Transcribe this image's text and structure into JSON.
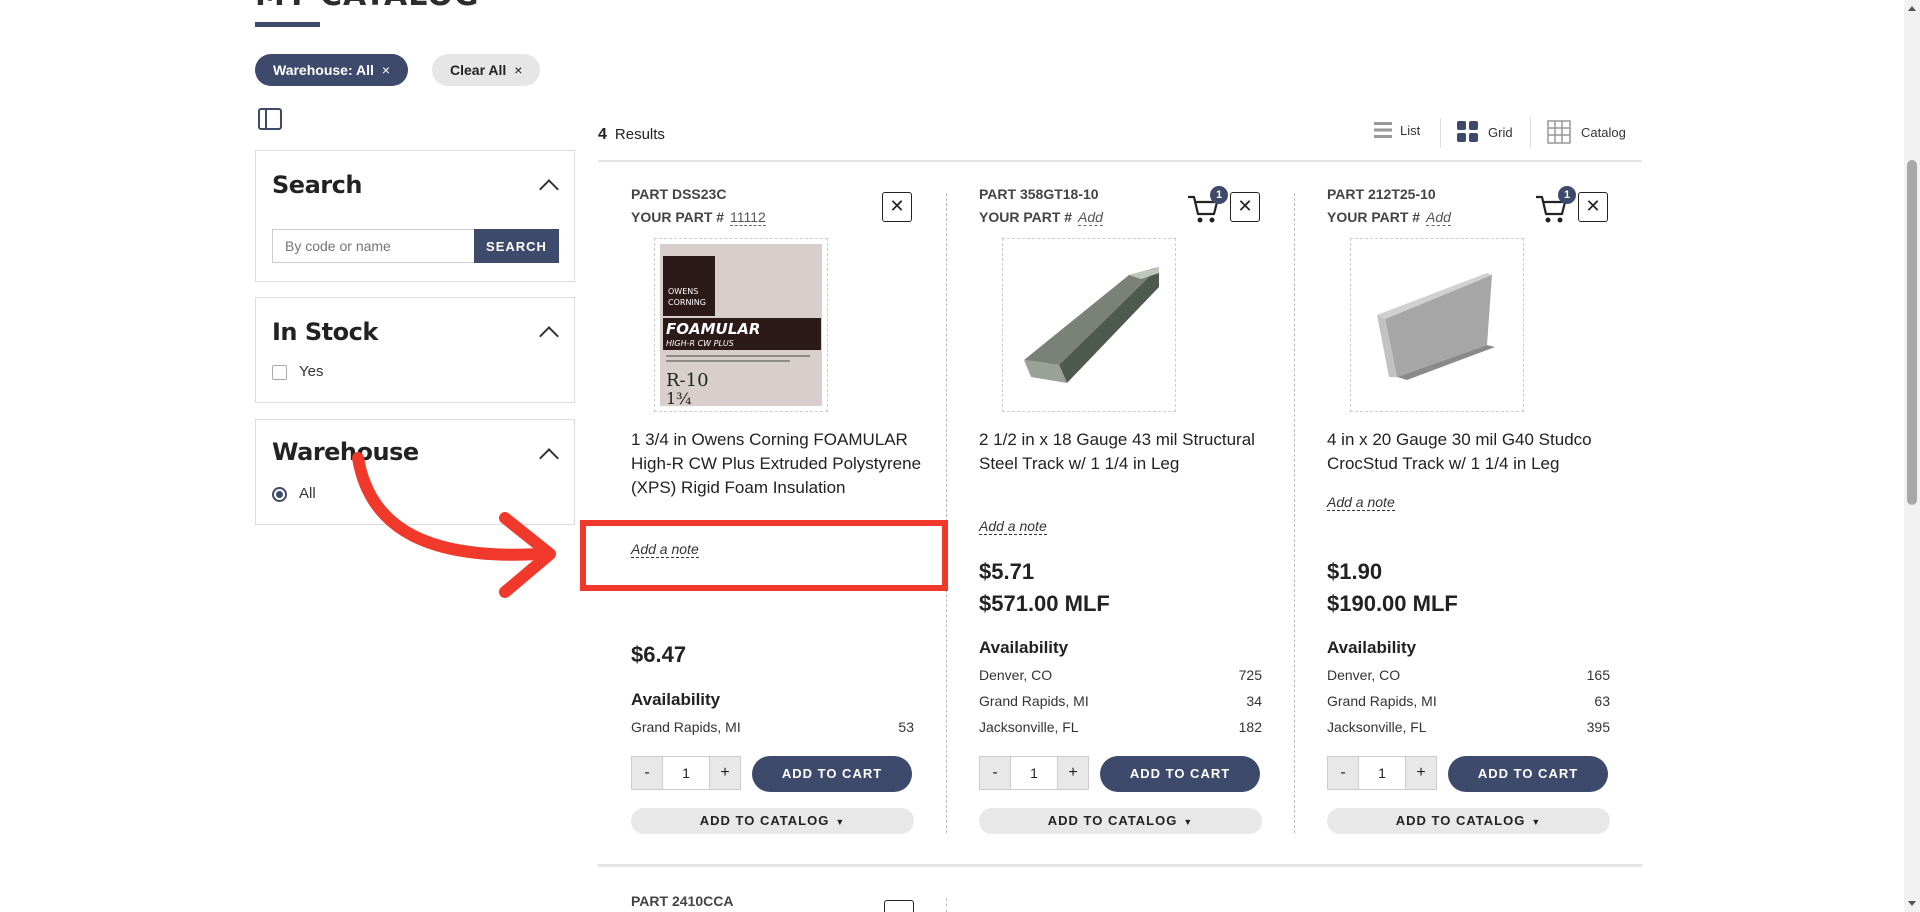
{
  "page": {
    "title": "MY CATALOG"
  },
  "filters_applied": {
    "warehouse_chip": "Warehouse: All",
    "clear_all": "Clear All",
    "remove_glyph": "×"
  },
  "sidebar": {
    "search": {
      "title": "Search",
      "placeholder": "By code or name",
      "button": "SEARCH"
    },
    "in_stock": {
      "title": "In Stock",
      "option": "Yes"
    },
    "warehouse": {
      "title": "Warehouse",
      "option": "All"
    }
  },
  "results": {
    "count": "4",
    "label": "Results"
  },
  "views": {
    "list": "List",
    "grid": "Grid",
    "catalog": "Catalog"
  },
  "products": [
    {
      "part": "PART DSS23C",
      "your_part_label": "YOUR PART #",
      "your_part_value": "11112",
      "name": "1 3/4 in Owens Corning FOAMULAR High-R CW Plus Extruded Polystyrene (XPS) Rigid Foam Insulation",
      "note": "Add a note",
      "price": "$6.47",
      "availability_title": "Availability",
      "availability": [
        {
          "location": "Grand Rapids, MI",
          "qty": "53"
        }
      ],
      "qty": "1",
      "add_to_cart": "ADD TO CART",
      "add_to_catalog": "ADD TO CATALOG",
      "image_text": {
        "brand1": "OWENS",
        "brand2": "CORNING",
        "product": "FOAMULAR",
        "subtitle": "HIGH-R CW PLUS",
        "r_value": "R-10",
        "thickness": "1¾"
      }
    },
    {
      "part": "PART 358GT18-10",
      "your_part_label": "YOUR PART #",
      "your_part_value": "Add",
      "cart_badge": "1",
      "name": "2 1/2 in x 18 Gauge 43 mil Structural Steel Track w/ 1 1/4 in Leg",
      "note": "Add a note",
      "price": "$5.71",
      "price_mlf": "$571.00 MLF",
      "availability_title": "Availability",
      "availability": [
        {
          "location": "Denver, CO",
          "qty": "725"
        },
        {
          "location": "Grand Rapids, MI",
          "qty": "34"
        },
        {
          "location": "Jacksonville, FL",
          "qty": "182"
        }
      ],
      "qty": "1",
      "add_to_cart": "ADD TO CART",
      "add_to_catalog": "ADD TO CATALOG"
    },
    {
      "part": "PART 212T25-10",
      "your_part_label": "YOUR PART #",
      "your_part_value": "Add",
      "cart_badge": "1",
      "name": "4 in x 20 Gauge 30 mil G40 Studco CrocStud Track w/ 1 1/4 in Leg",
      "note": "Add a note",
      "price": "$1.90",
      "price_mlf": "$190.00 MLF",
      "availability_title": "Availability",
      "availability": [
        {
          "location": "Denver, CO",
          "qty": "165"
        },
        {
          "location": "Grand Rapids, MI",
          "qty": "63"
        },
        {
          "location": "Jacksonville, FL",
          "qty": "395"
        }
      ],
      "qty": "1",
      "add_to_cart": "ADD TO CART",
      "add_to_catalog": "ADD TO CATALOG"
    }
  ],
  "next_product": {
    "part": "PART 2410CCA"
  },
  "controls": {
    "minus": "-",
    "plus": "+",
    "close": "✕"
  },
  "colors": {
    "accent": "#3e4a6b",
    "annotation": "#f0382b"
  }
}
